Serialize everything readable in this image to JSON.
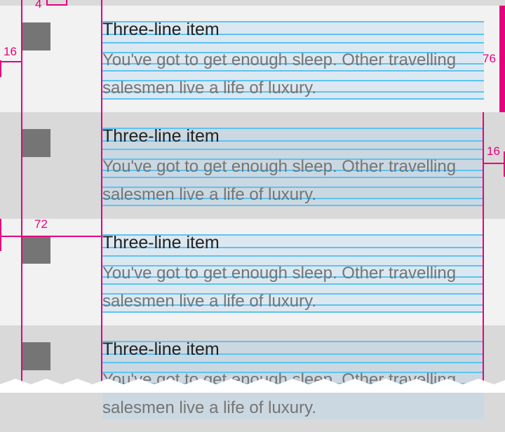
{
  "list": {
    "items": [
      {
        "title": "Three-line item",
        "body": "You've got to get enough sleep. Other travelling salesmen live a life of luxury."
      },
      {
        "title": "Three-line item",
        "body": "You've got to get enough sleep. Other travelling salesmen live a life of luxury."
      },
      {
        "title": "Three-line item",
        "body": "You've got to get enough sleep. Other travelling salesmen live a life of luxury."
      },
      {
        "title": "Three-line item",
        "body": "You've got to get enough sleep. Other travelling salesmen live a life of luxury."
      }
    ]
  },
  "redlines": {
    "top_spacing": "4",
    "avatar_left_margin": "16",
    "text_height": "76",
    "right_margin": "16",
    "text_left_offset": "72"
  },
  "colors": {
    "redline": "#e6007e",
    "baseline_grid": "#5ec3f0",
    "avatar_placeholder": "#757575",
    "row_light": "#f2f2f2",
    "row_dark": "#d9d9d9"
  }
}
